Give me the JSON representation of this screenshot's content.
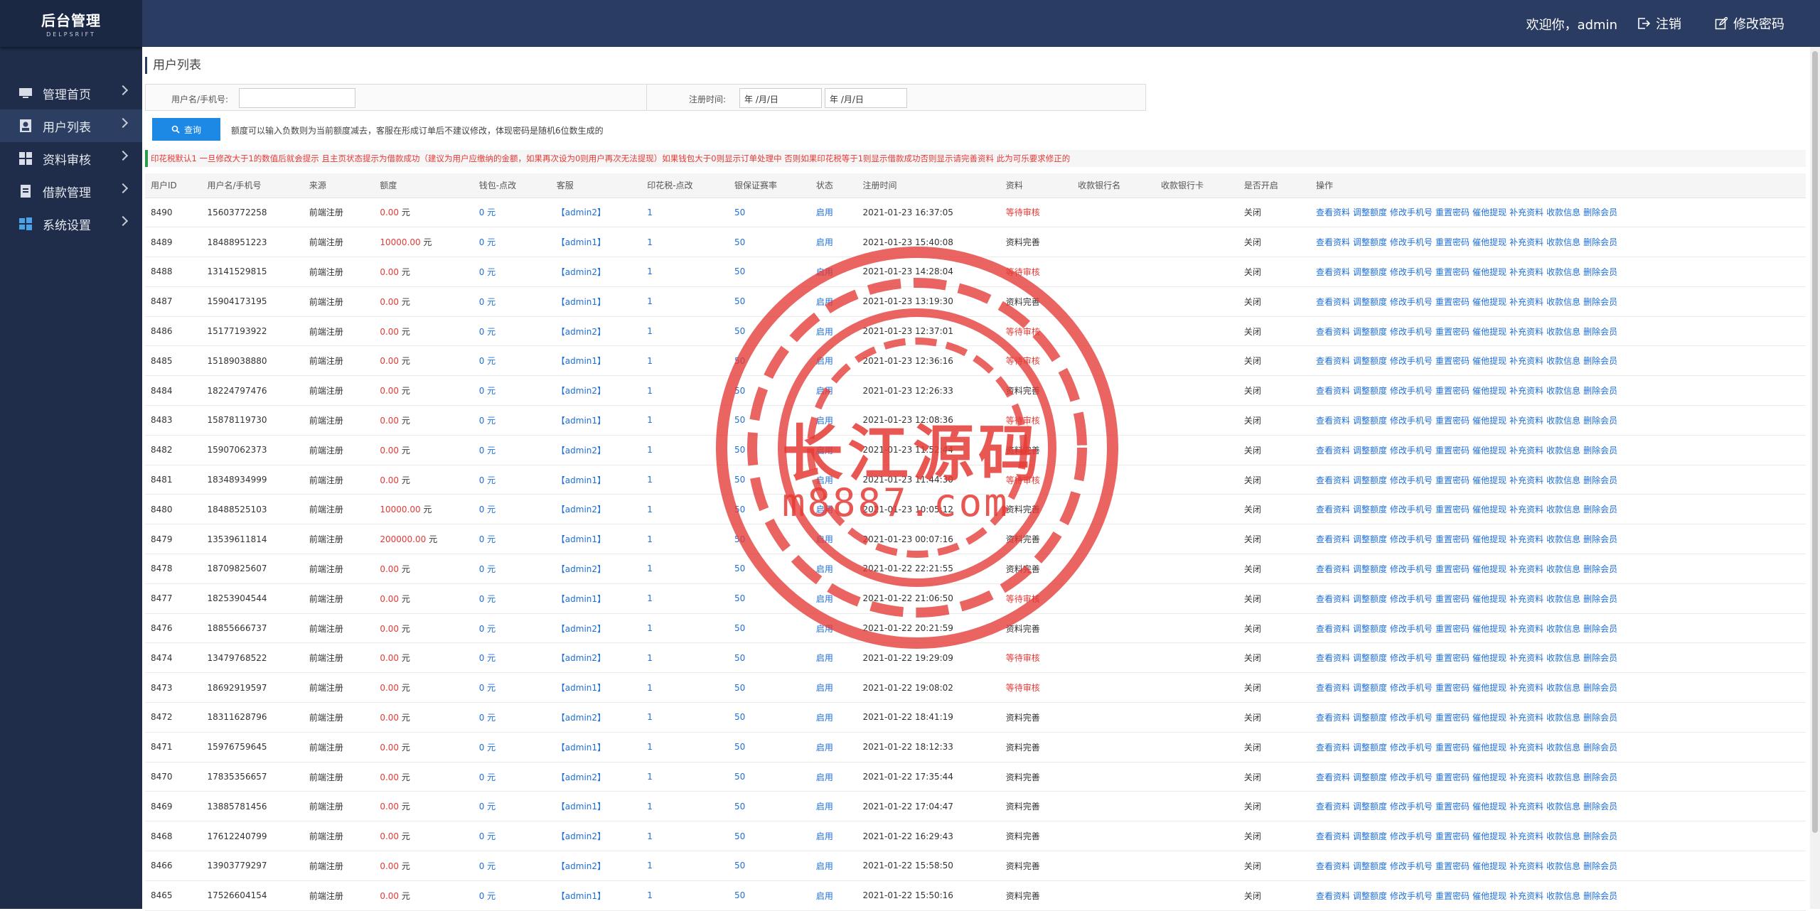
{
  "sidebar": {
    "logo_title": "后台管理",
    "logo_sub": "DELPSRIFT",
    "items": [
      {
        "label": "管理首页",
        "icon": "monitor-icon"
      },
      {
        "label": "用户列表",
        "icon": "user-icon"
      },
      {
        "label": "资料审核",
        "icon": "grid-icon"
      },
      {
        "label": "借款管理",
        "icon": "document-icon"
      },
      {
        "label": "系统设置",
        "icon": "windows-icon"
      }
    ]
  },
  "topbar": {
    "welcome": "欢迎你，admin",
    "logout": "注销",
    "change_password": "修改密码"
  },
  "page": {
    "title": "用户列表",
    "filter_user_label": "用户名/手机号:",
    "filter_user_value": "",
    "filter_date_label": "注册时间:",
    "date_start_placeholder": "年 /月/日",
    "date_end_placeholder": "年 /月/日",
    "query_button": "查询",
    "hint": "额度可以输入负数则为当前额度减去，客服在形成订单后不建议修改，体现密码是随机6位数生成的",
    "notice": "印花税默认1 一旦修改大于1的数值后就会提示 且主页状态提示为借款成功（建议为用户应缴纳的金额，如果再次设为0则用户再次无法提现）如果钱包大于0则显示订单处理中 否则如果印花税等于1则显示借款成功否则显示请完善资料 此为可乐要求修正的"
  },
  "table": {
    "headers": [
      "用户ID",
      "用户名/手机号",
      "来源",
      "额度",
      "钱包-点改",
      "客服",
      "印花税-点改",
      "银保证赛率",
      "状态",
      "注册时间",
      "资料",
      "收款银行名",
      "收款银行卡",
      "是否开启",
      "操作"
    ],
    "ops": [
      "查看资料",
      "调整额度",
      "修改手机号",
      "重置密码",
      "催他提现",
      "补充资料",
      "收款信息",
      "删除会员"
    ],
    "rows": [
      {
        "id": "8490",
        "phone": "15603772258",
        "source": "前端注册",
        "quota": "0.00",
        "wallet": "0 元",
        "cs": "【admin2】",
        "tax": "1",
        "rate": "50",
        "status": "启用",
        "time": "2021-01-23 16:37:05",
        "info": "等待审核",
        "open": "关闭"
      },
      {
        "id": "8489",
        "phone": "18488951223",
        "source": "前端注册",
        "quota": "10000.00",
        "wallet": "0 元",
        "cs": "【admin1】",
        "tax": "1",
        "rate": "50",
        "status": "启用",
        "time": "2021-01-23 15:40:08",
        "info": "资料完善",
        "open": "关闭"
      },
      {
        "id": "8488",
        "phone": "13141529815",
        "source": "前端注册",
        "quota": "0.00",
        "wallet": "0 元",
        "cs": "【admin2】",
        "tax": "1",
        "rate": "50",
        "status": "启用",
        "time": "2021-01-23 14:28:04",
        "info": "等待审核",
        "open": "关闭"
      },
      {
        "id": "8487",
        "phone": "15904173195",
        "source": "前端注册",
        "quota": "0.00",
        "wallet": "0 元",
        "cs": "【admin1】",
        "tax": "1",
        "rate": "50",
        "status": "启用",
        "time": "2021-01-23 13:19:30",
        "info": "资料完善",
        "open": "关闭"
      },
      {
        "id": "8486",
        "phone": "15177193922",
        "source": "前端注册",
        "quota": "0.00",
        "wallet": "0 元",
        "cs": "【admin2】",
        "tax": "1",
        "rate": "50",
        "status": "启用",
        "time": "2021-01-23 12:37:01",
        "info": "等待审核",
        "open": "关闭"
      },
      {
        "id": "8485",
        "phone": "15189038880",
        "source": "前端注册",
        "quota": "0.00",
        "wallet": "0 元",
        "cs": "【admin1】",
        "tax": "1",
        "rate": "50",
        "status": "启用",
        "time": "2021-01-23 12:36:16",
        "info": "等待审核",
        "open": "关闭"
      },
      {
        "id": "8484",
        "phone": "18224797476",
        "source": "前端注册",
        "quota": "0.00",
        "wallet": "0 元",
        "cs": "【admin2】",
        "tax": "1",
        "rate": "50",
        "status": "启用",
        "time": "2021-01-23 12:26:33",
        "info": "资料完善",
        "open": "关闭"
      },
      {
        "id": "8483",
        "phone": "15878119730",
        "source": "前端注册",
        "quota": "0.00",
        "wallet": "0 元",
        "cs": "【admin1】",
        "tax": "1",
        "rate": "50",
        "status": "启用",
        "time": "2021-01-23 12:08:36",
        "info": "等待审核",
        "open": "关闭"
      },
      {
        "id": "8482",
        "phone": "15907062373",
        "source": "前端注册",
        "quota": "0.00",
        "wallet": "0 元",
        "cs": "【admin2】",
        "tax": "1",
        "rate": "50",
        "status": "启用",
        "time": "2021-01-23 11:52:44",
        "info": "资料完善",
        "open": "关闭"
      },
      {
        "id": "8481",
        "phone": "18348934999",
        "source": "前端注册",
        "quota": "0.00",
        "wallet": "0 元",
        "cs": "【admin1】",
        "tax": "1",
        "rate": "50",
        "status": "启用",
        "time": "2021-01-23 11:44:30",
        "info": "等待审核",
        "open": "关闭"
      },
      {
        "id": "8480",
        "phone": "18488525103",
        "source": "前端注册",
        "quota": "10000.00",
        "wallet": "0 元",
        "cs": "【admin2】",
        "tax": "1",
        "rate": "50",
        "status": "启用",
        "time": "2021-01-23 10:05:12",
        "info": "资料完善",
        "open": "关闭"
      },
      {
        "id": "8479",
        "phone": "13539611814",
        "source": "前端注册",
        "quota": "200000.00",
        "wallet": "0 元",
        "cs": "【admin1】",
        "tax": "1",
        "rate": "50",
        "status": "启用",
        "time": "2021-01-23 00:07:16",
        "info": "资料完善",
        "open": "关闭"
      },
      {
        "id": "8478",
        "phone": "18709825607",
        "source": "前端注册",
        "quota": "0.00",
        "wallet": "0 元",
        "cs": "【admin2】",
        "tax": "1",
        "rate": "50",
        "status": "启用",
        "time": "2021-01-22 22:21:55",
        "info": "资料完善",
        "open": "关闭"
      },
      {
        "id": "8477",
        "phone": "18253904544",
        "source": "前端注册",
        "quota": "0.00",
        "wallet": "0 元",
        "cs": "【admin1】",
        "tax": "1",
        "rate": "50",
        "status": "启用",
        "time": "2021-01-22 21:06:50",
        "info": "等待审核",
        "open": "关闭"
      },
      {
        "id": "8476",
        "phone": "18855666737",
        "source": "前端注册",
        "quota": "0.00",
        "wallet": "0 元",
        "cs": "【admin2】",
        "tax": "1",
        "rate": "50",
        "status": "启用",
        "time": "2021-01-22 20:21:59",
        "info": "资料完善",
        "open": "关闭"
      },
      {
        "id": "8474",
        "phone": "13479768522",
        "source": "前端注册",
        "quota": "0.00",
        "wallet": "0 元",
        "cs": "【admin2】",
        "tax": "1",
        "rate": "50",
        "status": "启用",
        "time": "2021-01-22 19:29:09",
        "info": "等待审核",
        "open": "关闭"
      },
      {
        "id": "8473",
        "phone": "18692919597",
        "source": "前端注册",
        "quota": "0.00",
        "wallet": "0 元",
        "cs": "【admin1】",
        "tax": "1",
        "rate": "50",
        "status": "启用",
        "time": "2021-01-22 19:08:02",
        "info": "等待审核",
        "open": "关闭"
      },
      {
        "id": "8472",
        "phone": "18311628796",
        "source": "前端注册",
        "quota": "0.00",
        "wallet": "0 元",
        "cs": "【admin2】",
        "tax": "1",
        "rate": "50",
        "status": "启用",
        "time": "2021-01-22 18:41:19",
        "info": "资料完善",
        "open": "关闭"
      },
      {
        "id": "8471",
        "phone": "15976759645",
        "source": "前端注册",
        "quota": "0.00",
        "wallet": "0 元",
        "cs": "【admin1】",
        "tax": "1",
        "rate": "50",
        "status": "启用",
        "time": "2021-01-22 18:12:33",
        "info": "资料完善",
        "open": "关闭"
      },
      {
        "id": "8470",
        "phone": "17835356657",
        "source": "前端注册",
        "quota": "0.00",
        "wallet": "0 元",
        "cs": "【admin2】",
        "tax": "1",
        "rate": "50",
        "status": "启用",
        "time": "2021-01-22 17:35:44",
        "info": "资料完善",
        "open": "关闭"
      },
      {
        "id": "8469",
        "phone": "13885781456",
        "source": "前端注册",
        "quota": "0.00",
        "wallet": "0 元",
        "cs": "【admin1】",
        "tax": "1",
        "rate": "50",
        "status": "启用",
        "time": "2021-01-22 17:04:47",
        "info": "资料完善",
        "open": "关闭"
      },
      {
        "id": "8468",
        "phone": "17612240799",
        "source": "前端注册",
        "quota": "0.00",
        "wallet": "0 元",
        "cs": "【admin2】",
        "tax": "1",
        "rate": "50",
        "status": "启用",
        "time": "2021-01-22 16:29:43",
        "info": "资料完善",
        "open": "关闭"
      },
      {
        "id": "8466",
        "phone": "13903779297",
        "source": "前端注册",
        "quota": "0.00",
        "wallet": "0 元",
        "cs": "【admin2】",
        "tax": "1",
        "rate": "50",
        "status": "启用",
        "time": "2021-01-22 15:58:50",
        "info": "资料完善",
        "open": "关闭"
      },
      {
        "id": "8465",
        "phone": "17526604154",
        "source": "前端注册",
        "quota": "0.00",
        "wallet": "0 元",
        "cs": "【admin1】",
        "tax": "1",
        "rate": "50",
        "status": "启用",
        "time": "2021-01-22 15:50:16",
        "info": "资料完善",
        "open": "关闭"
      }
    ]
  },
  "watermark": {
    "text1": "长江源码",
    "text2": "m8887.com"
  },
  "colors": {
    "sidebar_bg": "#1f2d4a",
    "topbar_bg": "#2a3c61",
    "accent": "#1e88e5",
    "red": "#e53935",
    "link": "#1e6fd9"
  }
}
